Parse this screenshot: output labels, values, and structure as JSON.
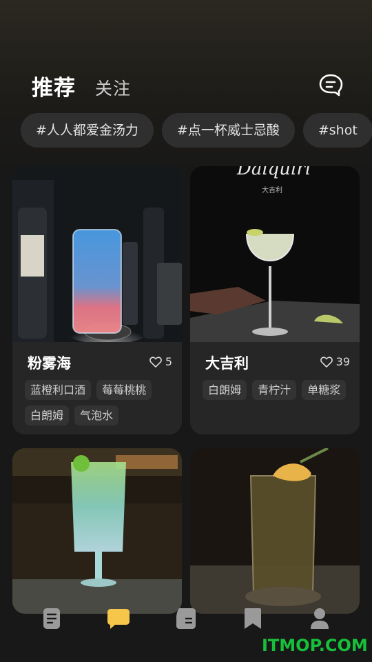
{
  "header": {
    "tab_recommend": "推荐",
    "tab_follow": "关注",
    "message_icon": "chat-bubble-icon"
  },
  "hashtags": [
    "#人人都爱金汤力",
    "#点一杯威士忌酸",
    "#shot"
  ],
  "cards": [
    {
      "title": "粉雾海",
      "likes": "5",
      "tags": [
        "蓝橙利口酒",
        "莓莓桃桃",
        "白朗姆",
        "气泡水"
      ]
    },
    {
      "title": "大吉利",
      "likes": "39",
      "tags": [
        "白朗姆",
        "青柠汁",
        "单糖浆"
      ],
      "image_text": "Daiquiri",
      "image_subtext": "大吉利"
    },
    {
      "title": "",
      "likes": "",
      "tags": []
    },
    {
      "title": "",
      "likes": "",
      "tags": []
    }
  ],
  "nav": {
    "items": [
      "document-icon",
      "chat-icon",
      "card-icon",
      "bookmark-icon",
      "user-icon"
    ],
    "active_color": "#f5c64a",
    "inactive_color": "#9a9a9a"
  },
  "watermark": "ITMOP.COM",
  "colors": {
    "background": "#181818",
    "card": "#262626",
    "chip": "#2f2f2f",
    "watermark": "#17c03a"
  }
}
